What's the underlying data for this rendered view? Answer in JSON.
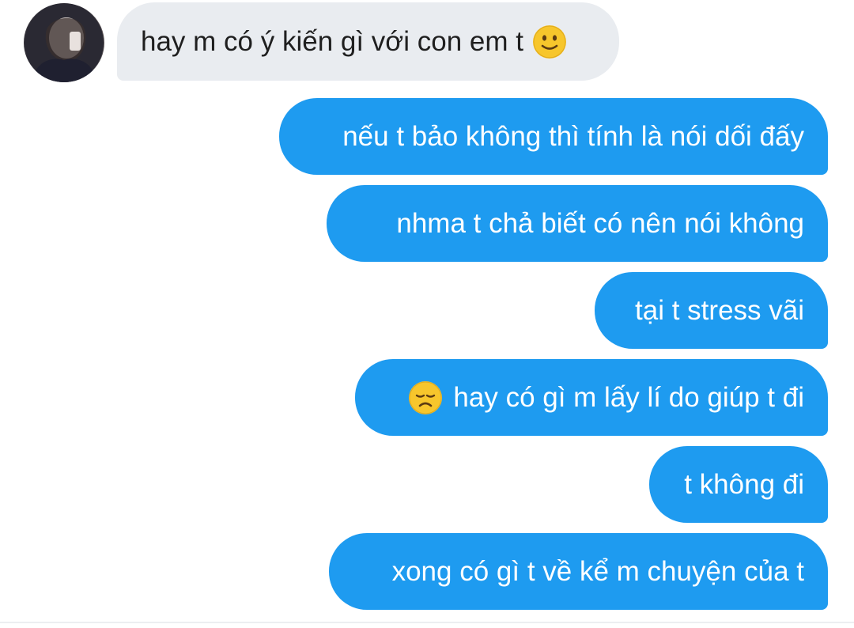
{
  "conversation": {
    "incoming_messages": [
      {
        "text": "hay m có ý kiến gì với con em t",
        "emoji": "slightly-smiling-face"
      }
    ],
    "outgoing_messages": [
      {
        "text": "nếu t bảo không thì tính là nói dối đấy"
      },
      {
        "text": "nhma t chả biết có nên nói không"
      },
      {
        "text": "tại t stress vãi"
      },
      {
        "text": "hay có gì m lấy lí do giúp t đi",
        "emoji": "disappointed-face"
      },
      {
        "text": "t không đi"
      },
      {
        "text": "xong có gì t về kể m chuyện của t"
      }
    ]
  },
  "colors": {
    "outgoing_bubble": "#1e9bf0",
    "incoming_bubble": "#e9ecf0",
    "emoji_yellow": "#f7c62c"
  }
}
